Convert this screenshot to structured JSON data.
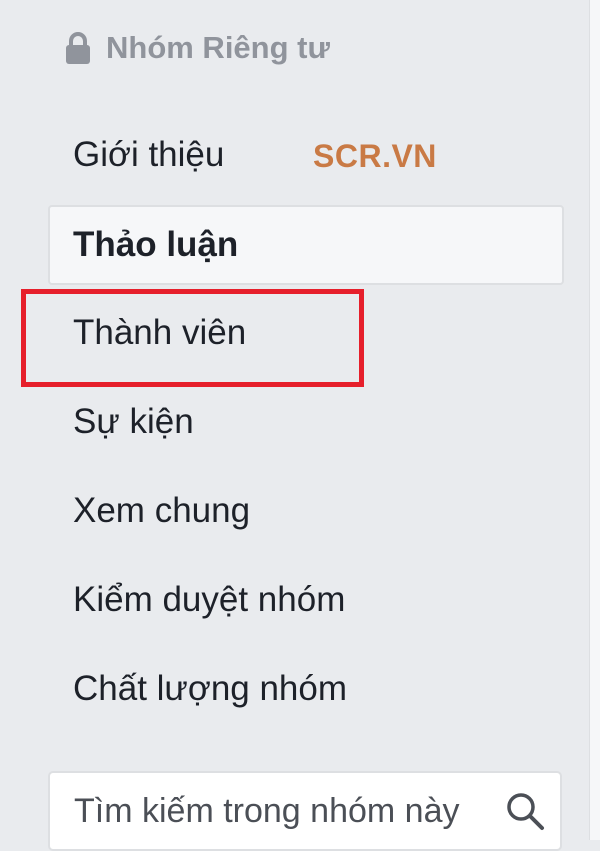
{
  "header": {
    "privacy_label": "Nhóm Riêng tư",
    "privacy_icon": "lock-icon"
  },
  "watermark": "SCR.VN",
  "nav": {
    "items": [
      {
        "label": "Giới thiệu",
        "active": false
      },
      {
        "label": "Thảo luận",
        "active": true
      },
      {
        "label": "Thành viên",
        "active": false,
        "highlighted": true
      },
      {
        "label": "Sự kiện",
        "active": false
      },
      {
        "label": "Xem chung",
        "active": false
      },
      {
        "label": "Kiểm duyệt nhóm",
        "active": false
      },
      {
        "label": "Chất lượng nhóm",
        "active": false
      }
    ]
  },
  "search": {
    "placeholder": "Tìm kiếm trong nhóm này",
    "value": "",
    "icon": "search-icon"
  },
  "colors": {
    "background": "#e9ebee",
    "text": "#1d2129",
    "muted": "#90949c",
    "highlight": "#e61f2b",
    "watermark": "#c97a45"
  }
}
